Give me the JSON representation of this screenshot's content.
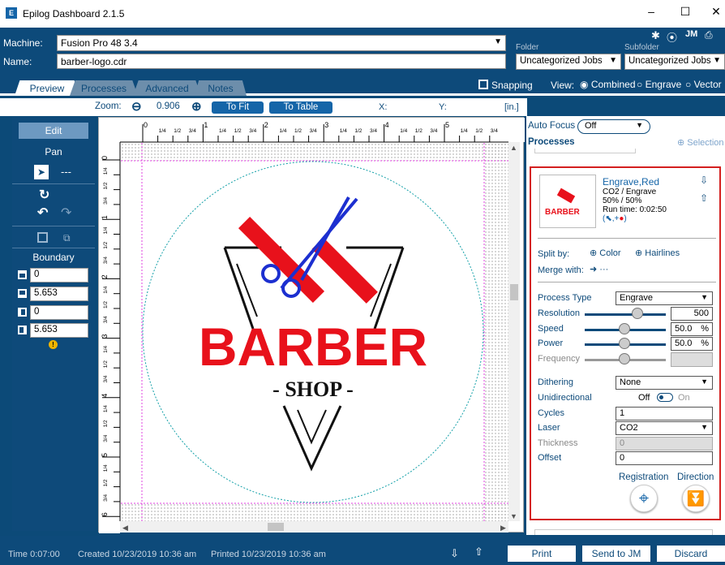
{
  "window": {
    "app_title": "Epilog Dashboard 2.1.5",
    "minimize": "–",
    "maximize": "☐",
    "close": "✕"
  },
  "machine": {
    "machine_label": "Machine:",
    "machine_value": "Fusion Pro 48 3.4",
    "name_label": "Name:",
    "name_value": "barber-logo.cdr",
    "folder_label": "Folder",
    "folder_value": "Uncategorized Jobs",
    "subfolder_label": "Subfolder",
    "subfolder_value": "Uncategorized Jobs",
    "header_icons": [
      "gear-icon",
      "activity-icon",
      "JM",
      "printer-icon"
    ],
    "jm": "JM"
  },
  "tabs": [
    "Preview",
    "Processes",
    "Advanced",
    "Notes"
  ],
  "view": {
    "snapping": "Snapping",
    "view_label": "View:",
    "combined": "Combined",
    "engrave": "Engrave",
    "vector": "Vector"
  },
  "zoom": {
    "label": "Zoom:",
    "value": "0.906",
    "to_fit": "To Fit",
    "to_table": "To Table",
    "x_label": "X:",
    "y_label": "Y:",
    "units": "[in.]"
  },
  "ruler": {
    "top": [
      "0",
      "1/4",
      "1/2",
      "3/4",
      "1",
      "1/4",
      "1/2",
      "3/4",
      "2",
      "1/4",
      "1/2",
      "3/4",
      "3",
      "1/4",
      "1/2",
      "3/4",
      "4",
      "1/4",
      "1/2",
      "3/4",
      "5",
      "1/4",
      "1/2",
      "3/4"
    ],
    "left": [
      "0",
      "1/4",
      "1/2",
      "3/4",
      "1",
      "1/4",
      "1/2",
      "3/4",
      "2",
      "1/4",
      "1/2",
      "3/4",
      "3",
      "1/4",
      "1/2",
      "3/4",
      "4",
      "1/4",
      "1/2",
      "3/4",
      "5",
      "1/4",
      "1/2",
      "3/4",
      "6"
    ]
  },
  "left_panel": {
    "edit": "Edit",
    "pan": "Pan",
    "pan_value": "---",
    "boundary": "Boundary",
    "boundary_values": [
      "0",
      "5.653",
      "0",
      "5.653"
    ],
    "warning": "!"
  },
  "artwork": {
    "barber": "BARBER",
    "shop": "- SHOP -"
  },
  "right_panel": {
    "auto_focus_label": "Auto Focus",
    "auto_focus_value": "Off",
    "processes_label": "Processes",
    "selection_label": "Selection",
    "process": {
      "name": "Engrave,Red",
      "type_line": "CO2 / Engrave",
      "percent_line": "50% / 50%",
      "run_time": "Run time: 0:02:50",
      "thumb_text": "BARBER"
    },
    "split_by": "Split by:",
    "color": "Color",
    "hairlines": "Hairlines",
    "merge_with": "Merge with:",
    "merge_more": "···",
    "process_type_label": "Process Type",
    "process_type": "Engrave",
    "resolution_label": "Resolution",
    "resolution": "500",
    "speed_label": "Speed",
    "speed": "50.0",
    "power_label": "Power",
    "power": "50.0",
    "percent": "%",
    "frequency_label": "Frequency",
    "dithering_label": "Dithering",
    "dithering": "None",
    "unidirectional_label": "Unidirectional",
    "off": "Off",
    "on": "On",
    "cycles_label": "Cycles",
    "cycles": "1",
    "laser_label": "Laser",
    "laser": "CO2",
    "thickness_label": "Thickness",
    "thickness": "0",
    "offset_label": "Offset",
    "offset": "0",
    "registration": "Registration",
    "direction": "Direction",
    "sliders": {
      "resolution": 0.6,
      "speed": 0.5,
      "power": 0.5,
      "frequency": 0.5
    }
  },
  "bottom": {
    "time": "Time 0:07:00",
    "created": "Created 10/23/2019 10:36 am",
    "printed": "Printed 10/23/2019 10:36 am",
    "print": "Print",
    "send_to_jm": "Send to JM",
    "discard": "Discard"
  }
}
